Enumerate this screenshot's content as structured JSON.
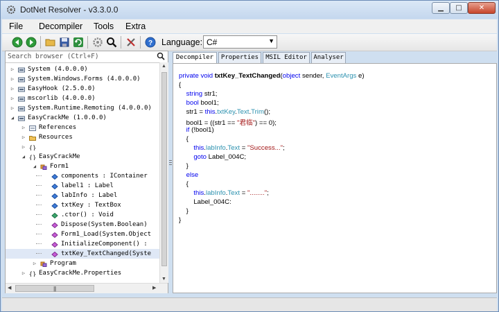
{
  "window": {
    "title": "DotNet Resolver - v3.3.0.0"
  },
  "menu": [
    "File",
    "Decompiler",
    "Tools",
    "Extra"
  ],
  "toolbar": {
    "language_label": "Language:",
    "language_value": "C#",
    "icons": [
      "back-icon",
      "forward-icon",
      "open-folder-icon",
      "save-icon",
      "refresh-icon",
      "settings-icon",
      "search-icon",
      "tools-icon",
      "help-icon"
    ]
  },
  "search": {
    "placeholder": "Search browser (Ctrl+F)"
  },
  "tree": [
    {
      "label": "System (4.0.0.0)",
      "indent": 0,
      "expander": "▷",
      "icon": "assembly-icon"
    },
    {
      "label": "System.Windows.Forms (4.0.0.0)",
      "indent": 0,
      "expander": "▷",
      "icon": "assembly-icon"
    },
    {
      "label": "EasyHook (2.5.0.0)",
      "indent": 0,
      "expander": "▷",
      "icon": "assembly-icon"
    },
    {
      "label": "mscorlib (4.0.0.0)",
      "indent": 0,
      "expander": "▷",
      "icon": "assembly-icon"
    },
    {
      "label": "System.Runtime.Remoting (4.0.0.0)",
      "indent": 0,
      "expander": "▷",
      "icon": "assembly-icon"
    },
    {
      "label": "EasyCrackMe (1.0.0.0)",
      "indent": 0,
      "expander": "◢",
      "icon": "assembly-icon"
    },
    {
      "label": "References",
      "indent": 1,
      "expander": "▷",
      "icon": "references-icon"
    },
    {
      "label": "Resources",
      "indent": 1,
      "expander": "▷",
      "icon": "folder-icon"
    },
    {
      "label": "",
      "indent": 1,
      "expander": "▷",
      "icon": "namespace-icon"
    },
    {
      "label": "EasyCrackMe",
      "indent": 1,
      "expander": "◢",
      "icon": "namespace-icon"
    },
    {
      "label": "Form1",
      "indent": 2,
      "expander": "◢",
      "icon": "class-icon"
    },
    {
      "label": "components : IContainer",
      "indent": 3,
      "expander": "",
      "icon": "field-icon"
    },
    {
      "label": "label1 : Label",
      "indent": 3,
      "expander": "",
      "icon": "field-icon"
    },
    {
      "label": "labInfo : Label",
      "indent": 3,
      "expander": "",
      "icon": "field-icon"
    },
    {
      "label": "txtKey : TextBox",
      "indent": 3,
      "expander": "",
      "icon": "field-icon"
    },
    {
      "label": ".ctor() : Void",
      "indent": 3,
      "expander": "",
      "icon": "constructor-icon"
    },
    {
      "label": "Dispose(System.Boolean)",
      "indent": 3,
      "expander": "",
      "icon": "method-icon"
    },
    {
      "label": "Form1_Load(System.Object",
      "indent": 3,
      "expander": "",
      "icon": "method-icon"
    },
    {
      "label": "InitializeComponent() :",
      "indent": 3,
      "expander": "",
      "icon": "method-icon"
    },
    {
      "label": "txtKey_TextChanged(Syste",
      "indent": 3,
      "expander": "",
      "icon": "method-icon",
      "selected": true
    },
    {
      "label": "Program",
      "indent": 2,
      "expander": "▷",
      "icon": "class-icon"
    },
    {
      "label": "EasyCrackMe.Properties",
      "indent": 1,
      "expander": "▷",
      "icon": "namespace-icon"
    }
  ],
  "tabs": [
    "Decompiler",
    "Properties",
    "MSIL Editor",
    "Analyser"
  ],
  "code": [
    [
      {
        "t": "private ",
        "c": "kw"
      },
      {
        "t": "void ",
        "c": "kw"
      },
      {
        "t": "txtKey_TextChanged",
        "c": "bold"
      },
      {
        "t": "(",
        "c": ""
      },
      {
        "t": "object ",
        "c": "kw"
      },
      {
        "t": "sender, ",
        "c": ""
      },
      {
        "t": "EventArgs ",
        "c": "tp"
      },
      {
        "t": "e)",
        "c": ""
      }
    ],
    [
      {
        "t": "{",
        "c": ""
      }
    ],
    [
      {
        "t": "    ",
        "c": ""
      },
      {
        "t": "string ",
        "c": "kw"
      },
      {
        "t": "str1;",
        "c": ""
      }
    ],
    [
      {
        "t": "    ",
        "c": ""
      },
      {
        "t": "bool ",
        "c": "kw"
      },
      {
        "t": "bool1;",
        "c": ""
      }
    ],
    [
      {
        "t": "    str1 = ",
        "c": ""
      },
      {
        "t": "this",
        "c": "kw"
      },
      {
        "t": ".",
        "c": ""
      },
      {
        "t": "txtKey",
        "c": "tp"
      },
      {
        "t": ".",
        "c": ""
      },
      {
        "t": "Text",
        "c": "tp"
      },
      {
        "t": ".",
        "c": ""
      },
      {
        "t": "Trim",
        "c": "tp"
      },
      {
        "t": "();",
        "c": ""
      }
    ],
    [
      {
        "t": "    bool1 = ((str1 == ",
        "c": ""
      },
      {
        "t": "\"君临\"",
        "c": "str"
      },
      {
        "t": ") == 0);",
        "c": ""
      }
    ],
    [
      {
        "t": "    ",
        "c": ""
      },
      {
        "t": "if ",
        "c": "kw"
      },
      {
        "t": "(!bool1)",
        "c": ""
      }
    ],
    [
      {
        "t": "    {",
        "c": ""
      }
    ],
    [
      {
        "t": "        ",
        "c": ""
      },
      {
        "t": "this",
        "c": "kw"
      },
      {
        "t": ".",
        "c": ""
      },
      {
        "t": "labInfo",
        "c": "tp"
      },
      {
        "t": ".",
        "c": ""
      },
      {
        "t": "Text",
        "c": "tp"
      },
      {
        "t": " = ",
        "c": ""
      },
      {
        "t": "\"Success...\"",
        "c": "str"
      },
      {
        "t": ";",
        "c": ""
      }
    ],
    [
      {
        "t": "        ",
        "c": ""
      },
      {
        "t": "goto ",
        "c": "kw"
      },
      {
        "t": "Label_004C;",
        "c": ""
      }
    ],
    [
      {
        "t": "    }",
        "c": ""
      }
    ],
    [
      {
        "t": "    ",
        "c": ""
      },
      {
        "t": "else",
        "c": "kw"
      }
    ],
    [
      {
        "t": "    {",
        "c": ""
      }
    ],
    [
      {
        "t": "        ",
        "c": ""
      },
      {
        "t": "this",
        "c": "kw"
      },
      {
        "t": ".",
        "c": ""
      },
      {
        "t": "labInfo",
        "c": "tp"
      },
      {
        "t": ".",
        "c": ""
      },
      {
        "t": "Text",
        "c": "tp"
      },
      {
        "t": " = ",
        "c": ""
      },
      {
        "t": "\"........\"",
        "c": "str"
      },
      {
        "t": ";",
        "c": ""
      }
    ],
    [
      {
        "t": "        Label_004C:",
        "c": ""
      }
    ],
    [
      {
        "t": "    }",
        "c": ""
      }
    ],
    [
      {
        "t": "}",
        "c": ""
      }
    ]
  ],
  "colors": {
    "keyword": "#0000ee",
    "type": "#2b91af",
    "string": "#a31515",
    "titlebar": "#c4d7ee"
  }
}
